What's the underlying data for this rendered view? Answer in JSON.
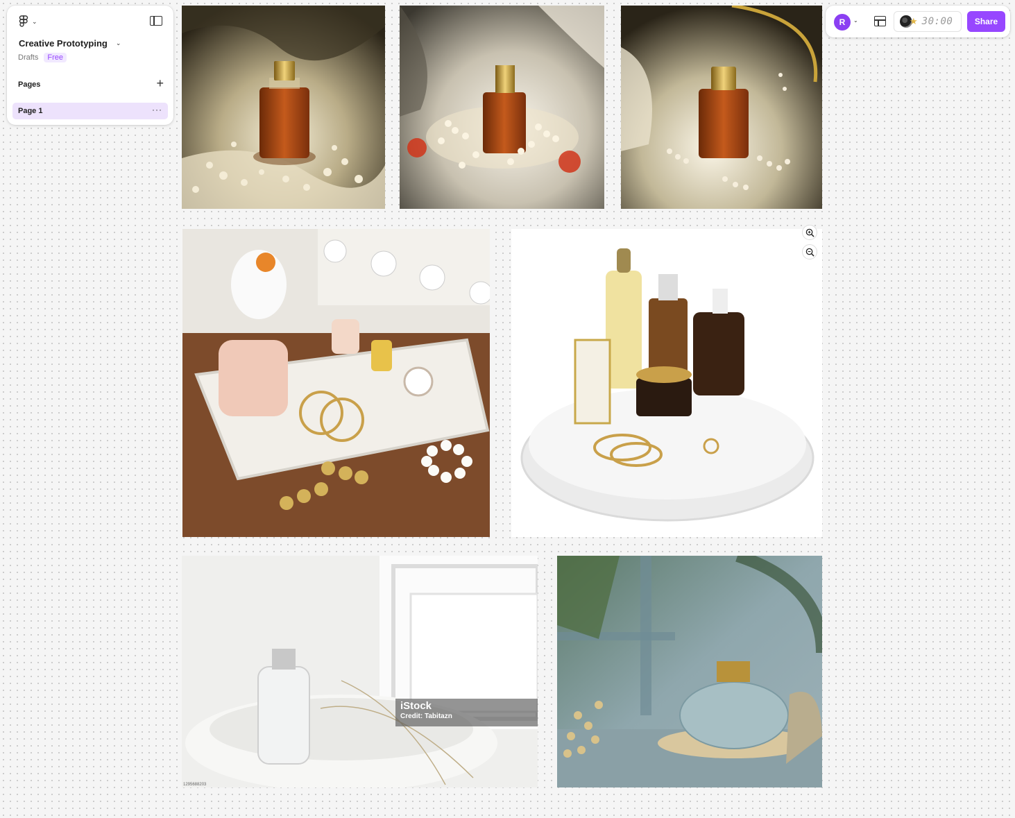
{
  "left_panel": {
    "file_title": "Creative Prototyping",
    "location": "Drafts",
    "plan_badge": "Free",
    "pages_header": "Pages",
    "add_page_symbol": "+",
    "pages": [
      {
        "label": "Page 1",
        "selected": true
      }
    ],
    "page_more_symbol": "···"
  },
  "toolbar": {
    "avatar_initial": "R",
    "avatar_color": "#8b3ff2",
    "timer": "30:00",
    "share_label": "Share",
    "accent_color": "#9747ff"
  },
  "canvas": {
    "images": [
      {
        "name": "perfume-silk-pearls-1"
      },
      {
        "name": "perfume-silk-pearls-roses"
      },
      {
        "name": "perfume-pearl-strand-mirror"
      },
      {
        "name": "vanity-tray-candle-jewelry"
      },
      {
        "name": "round-tray-serums-bracelet"
      },
      {
        "name": "clear-bottle-window-tray",
        "watermark_brand": "iStock",
        "watermark_credit": "Credit: Tabitazn",
        "stock_id": "1295688203"
      },
      {
        "name": "glass-bottle-palm-shadows"
      }
    ],
    "zoom_in_icon": "zoom-in-icon",
    "zoom_out_icon": "zoom-out-icon"
  }
}
